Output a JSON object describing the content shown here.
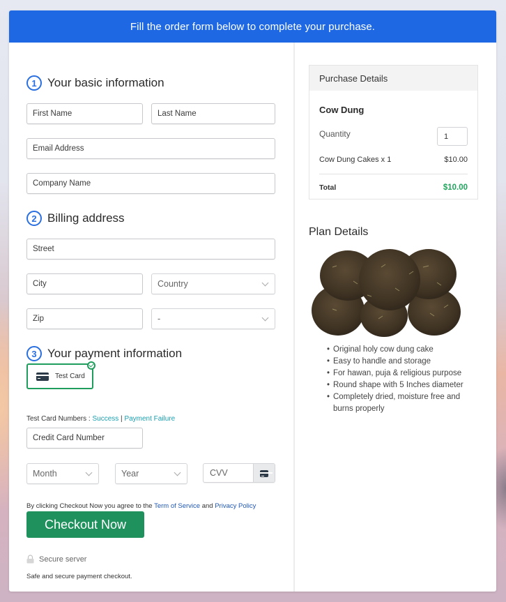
{
  "banner": {
    "text": "Fill the order form below to complete your purchase."
  },
  "sections": {
    "basic": {
      "step": "1",
      "title": "Your basic information"
    },
    "billing": {
      "step": "2",
      "title": "Billing address"
    },
    "payment": {
      "step": "3",
      "title": "Your payment information"
    }
  },
  "fields": {
    "first_name": "First Name",
    "last_name": "Last Name",
    "email": "Email Address",
    "company": "Company Name",
    "street": "Street",
    "city": "City",
    "country": "Country",
    "zip": "Zip",
    "state": "-",
    "card_number": "Credit Card Number",
    "month": "Month",
    "year": "Year",
    "cvv": "CVV"
  },
  "payment": {
    "method_label": "Test Card",
    "test_numbers_label": "Test Card Numbers : ",
    "success_link": "Success",
    "separator": " | ",
    "failure_link": "Payment Failure"
  },
  "terms": {
    "prefix": "By clicking Checkout Now you agree to the ",
    "tos": "Term of Service",
    "and": " and ",
    "privacy": "Privacy Policy"
  },
  "checkout": {
    "button": "Checkout Now",
    "secure": "Secure server",
    "safe_text": "Safe and secure payment checkout."
  },
  "purchase": {
    "header": "Purchase Details",
    "product": "Cow Dung",
    "quantity_label": "Quantity",
    "quantity_value": "1",
    "line_item": "Cow Dung Cakes x 1",
    "line_price": "$10.00",
    "total_label": "Total",
    "total_value": "$10.00",
    "total_color": "#22a45d"
  },
  "plan": {
    "title": "Plan Details",
    "image_alt": "cow dung cakes",
    "features": [
      "Original holy cow dung cake",
      "Easy to handle and storage",
      "For hawan, puja & religious purpose",
      "Round shape with 5 Inches diameter",
      "Completely dried, moisture free and burns properly"
    ]
  }
}
